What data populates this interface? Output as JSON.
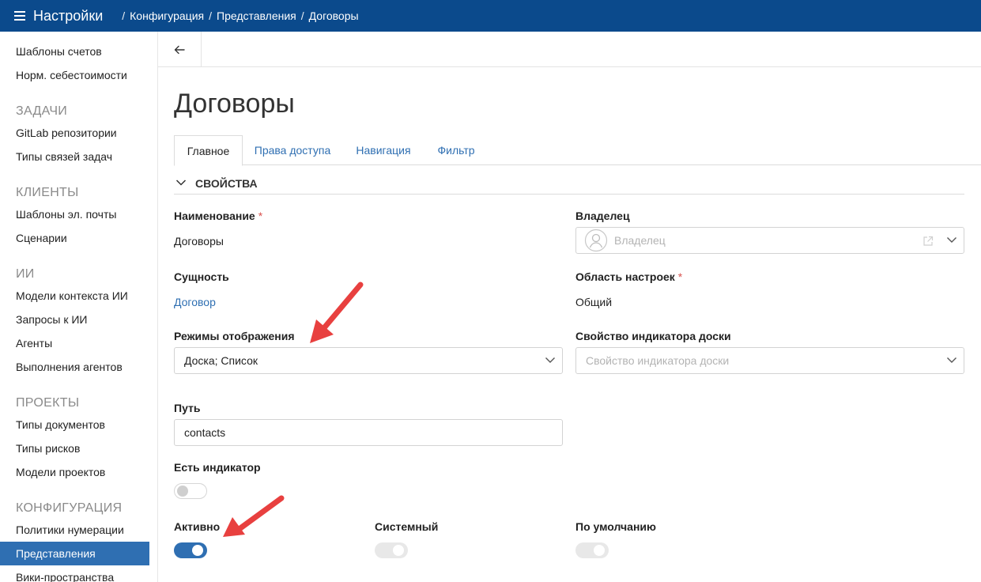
{
  "header": {
    "app_title": "Настройки",
    "breadcrumb": [
      "Конфигурация",
      "Представления",
      "Договоры"
    ]
  },
  "sidebar": {
    "items_top": [
      "Шаблоны счетов",
      "Норм. себестоимости"
    ],
    "groups": [
      {
        "title": "ЗАДАЧИ",
        "items": [
          "GitLab репозитории",
          "Типы связей задач"
        ]
      },
      {
        "title": "КЛИЕНТЫ",
        "items": [
          "Шаблоны эл. почты",
          "Сценарии"
        ]
      },
      {
        "title": "ИИ",
        "items": [
          "Модели контекста ИИ",
          "Запросы к ИИ",
          "Агенты",
          "Выполнения агентов"
        ]
      },
      {
        "title": "ПРОЕКТЫ",
        "items": [
          "Типы документов",
          "Типы рисков",
          "Модели проектов"
        ]
      },
      {
        "title": "КОНФИГУРАЦИЯ",
        "items": [
          "Политики нумерации",
          "Представления",
          "Вики-пространства"
        ]
      }
    ],
    "active": "Представления"
  },
  "page": {
    "title": "Договоры",
    "tabs": [
      "Главное",
      "Права доступа",
      "Навигация",
      "Фильтр"
    ],
    "active_tab": "Главное",
    "section": "СВОЙСТВА"
  },
  "form": {
    "name_label": "Наименование",
    "name_value": "Договоры",
    "owner_label": "Владелец",
    "owner_placeholder": "Владелец",
    "entity_label": "Сущность",
    "entity_value": "Договор",
    "scope_label": "Область настроек",
    "scope_value": "Общий",
    "display_modes_label": "Режимы отображения",
    "display_modes_value": "Доска; Список",
    "board_indicator_label": "Свойство индикатора доски",
    "board_indicator_placeholder": "Свойство индикатора доски",
    "path_label": "Путь",
    "path_value": "contacts",
    "has_indicator_label": "Есть индикатор",
    "has_indicator": false,
    "active_label": "Активно",
    "active": true,
    "system_label": "Системный",
    "system": true,
    "default_label": "По умолчанию",
    "default": true,
    "required_mark": "*"
  },
  "colors": {
    "topbar": "#0b4a8c",
    "accent": "#2f6fb2",
    "annotation_arrow": "#e8403f"
  }
}
